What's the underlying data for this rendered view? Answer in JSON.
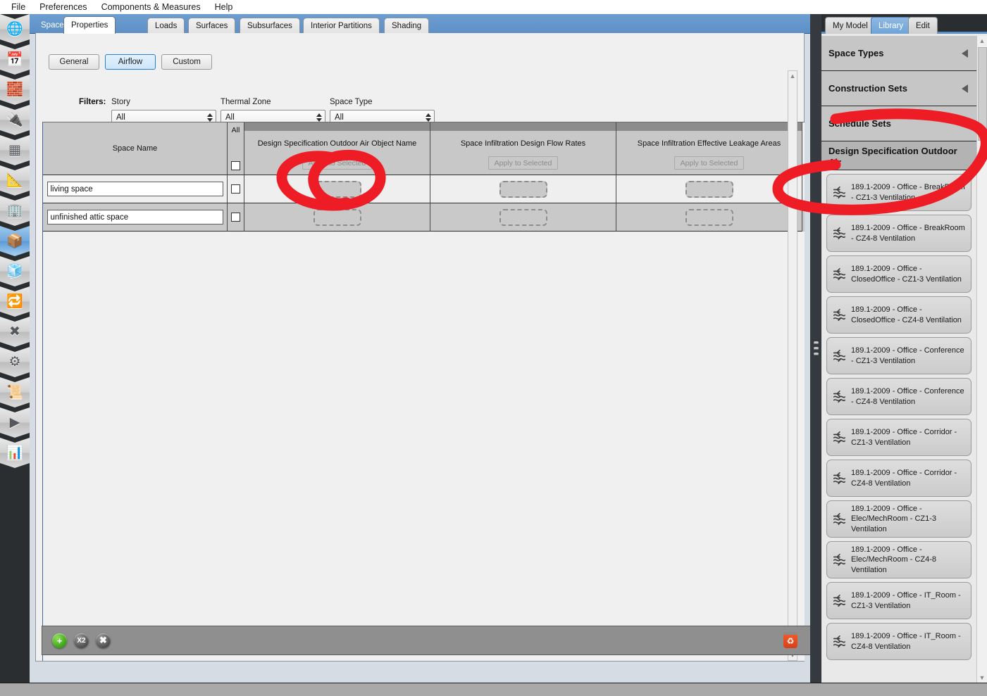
{
  "menubar": {
    "items": [
      {
        "label": "File"
      },
      {
        "label": "Preferences"
      },
      {
        "label": "Components & Measures"
      },
      {
        "label": "Help"
      }
    ]
  },
  "rail": {
    "items": [
      {
        "name": "site-icon",
        "glyph": "🌐",
        "selected": false
      },
      {
        "name": "schedules-icon",
        "glyph": "📅",
        "selected": false
      },
      {
        "name": "constructions-icon",
        "glyph": "🧱",
        "selected": false
      },
      {
        "name": "loads-icon",
        "glyph": "🔌",
        "selected": false
      },
      {
        "name": "space-types-icon",
        "glyph": "📦",
        "selected": false
      },
      {
        "name": "building-stories-icon",
        "glyph": "📐",
        "selected": false
      },
      {
        "name": "facility-icon",
        "glyph": "🏢",
        "selected": false
      },
      {
        "name": "spaces-icon",
        "glyph": "📦",
        "selected": true
      },
      {
        "name": "thermal-zones-icon",
        "glyph": "🧊",
        "selected": false
      },
      {
        "name": "hvac-systems-icon",
        "glyph": "🔁",
        "selected": false
      },
      {
        "name": "refrigeration-icon",
        "glyph": "✖",
        "selected": false
      },
      {
        "name": "variables-icon",
        "glyph": "⚙",
        "selected": false
      },
      {
        "name": "simulation-settings-icon",
        "glyph": "📜",
        "selected": false
      },
      {
        "name": "run-simulation-icon",
        "glyph": "▶",
        "selected": false
      },
      {
        "name": "results-summary-icon",
        "glyph": "📊",
        "selected": false
      }
    ]
  },
  "main": {
    "tabs": [
      {
        "label": "Spaces",
        "kind": "parent",
        "active": false
      },
      {
        "label": "Properties",
        "kind": "child",
        "active": true
      },
      {
        "label": "Loads",
        "kind": "child",
        "active": false
      },
      {
        "label": "Surfaces",
        "kind": "child",
        "active": false
      },
      {
        "label": "Subsurfaces",
        "kind": "child",
        "active": false
      },
      {
        "label": "Interior Partitions",
        "kind": "child",
        "active": false
      },
      {
        "label": "Shading",
        "kind": "child",
        "active": false
      }
    ],
    "subtabs": [
      {
        "label": "General",
        "active": false
      },
      {
        "label": "Airflow",
        "active": true
      },
      {
        "label": "Custom",
        "active": false
      }
    ],
    "filters": {
      "label": "Filters:",
      "fields": [
        {
          "title": "Story",
          "value": "All"
        },
        {
          "title": "Thermal Zone",
          "value": "All"
        },
        {
          "title": "Space Type",
          "value": "All"
        }
      ]
    },
    "grid": {
      "name_header": "Space Name",
      "all_header": "All",
      "columns": [
        {
          "title": "Design Specification Outdoor Air Object Name",
          "apply": "Apply to Selected"
        },
        {
          "title": "Space Infiltration Design Flow Rates",
          "apply": "Apply to Selected"
        },
        {
          "title": "Space Infiltration Effective Leakage Areas",
          "apply": "Apply to Selected"
        }
      ],
      "rows": [
        {
          "space_name": "living space",
          "checked": false,
          "cells": [
            "",
            "",
            ""
          ]
        },
        {
          "space_name": "unfinished attic space",
          "checked": false,
          "cells": [
            "",
            "",
            ""
          ]
        }
      ]
    },
    "actionbar": {
      "add_label": "+",
      "duplicate_label": "X2",
      "remove_label": "✖",
      "trash_label": "♻"
    }
  },
  "right": {
    "tabs": [
      {
        "label": "My Model",
        "active": false
      },
      {
        "label": "Library",
        "active": true
      },
      {
        "label": "Edit",
        "active": false
      }
    ],
    "sections": [
      {
        "label": "Space Types",
        "open": false
      },
      {
        "label": "Construction Sets",
        "open": false
      },
      {
        "label": "Schedule Sets",
        "open": false
      },
      {
        "label": "Design Specification Outdoor Air",
        "open": true
      }
    ],
    "items": [
      {
        "label": "189.1-2009 - Office - BreakRoom - CZ1-3 Ventilation"
      },
      {
        "label": "189.1-2009 - Office - BreakRoom - CZ4-8 Ventilation"
      },
      {
        "label": "189.1-2009 - Office - ClosedOffice - CZ1-3 Ventilation"
      },
      {
        "label": "189.1-2009 - Office - ClosedOffice - CZ4-8 Ventilation"
      },
      {
        "label": "189.1-2009 - Office - Conference - CZ1-3 Ventilation"
      },
      {
        "label": "189.1-2009 - Office - Conference - CZ4-8 Ventilation"
      },
      {
        "label": "189.1-2009 - Office - Corridor - CZ1-3 Ventilation"
      },
      {
        "label": "189.1-2009 - Office - Corridor - CZ4-8 Ventilation"
      },
      {
        "label": "189.1-2009 - Office - Elec/MechRoom - CZ1-3 Ventilation"
      },
      {
        "label": "189.1-2009 - Office - Elec/MechRoom - CZ4-8 Ventilation"
      },
      {
        "label": "189.1-2009 - Office - IT_Room - CZ1-3 Ventilation"
      },
      {
        "label": "189.1-2009 - Office - IT_Room - CZ4-8 Ventilation"
      }
    ]
  },
  "colors": {
    "accent_blue": "#5e8fc6",
    "annotation_red": "#ee1c25",
    "panel_gray": "#c8c8c8",
    "rail_dark": "#2b2e31",
    "selected_subtab": "#cde6fa"
  },
  "annotations": [
    {
      "name": "annotation-circle-outdoor-air-cell",
      "shape": "ellipse"
    },
    {
      "name": "annotation-circle-library-section",
      "shape": "ellipse"
    }
  ]
}
